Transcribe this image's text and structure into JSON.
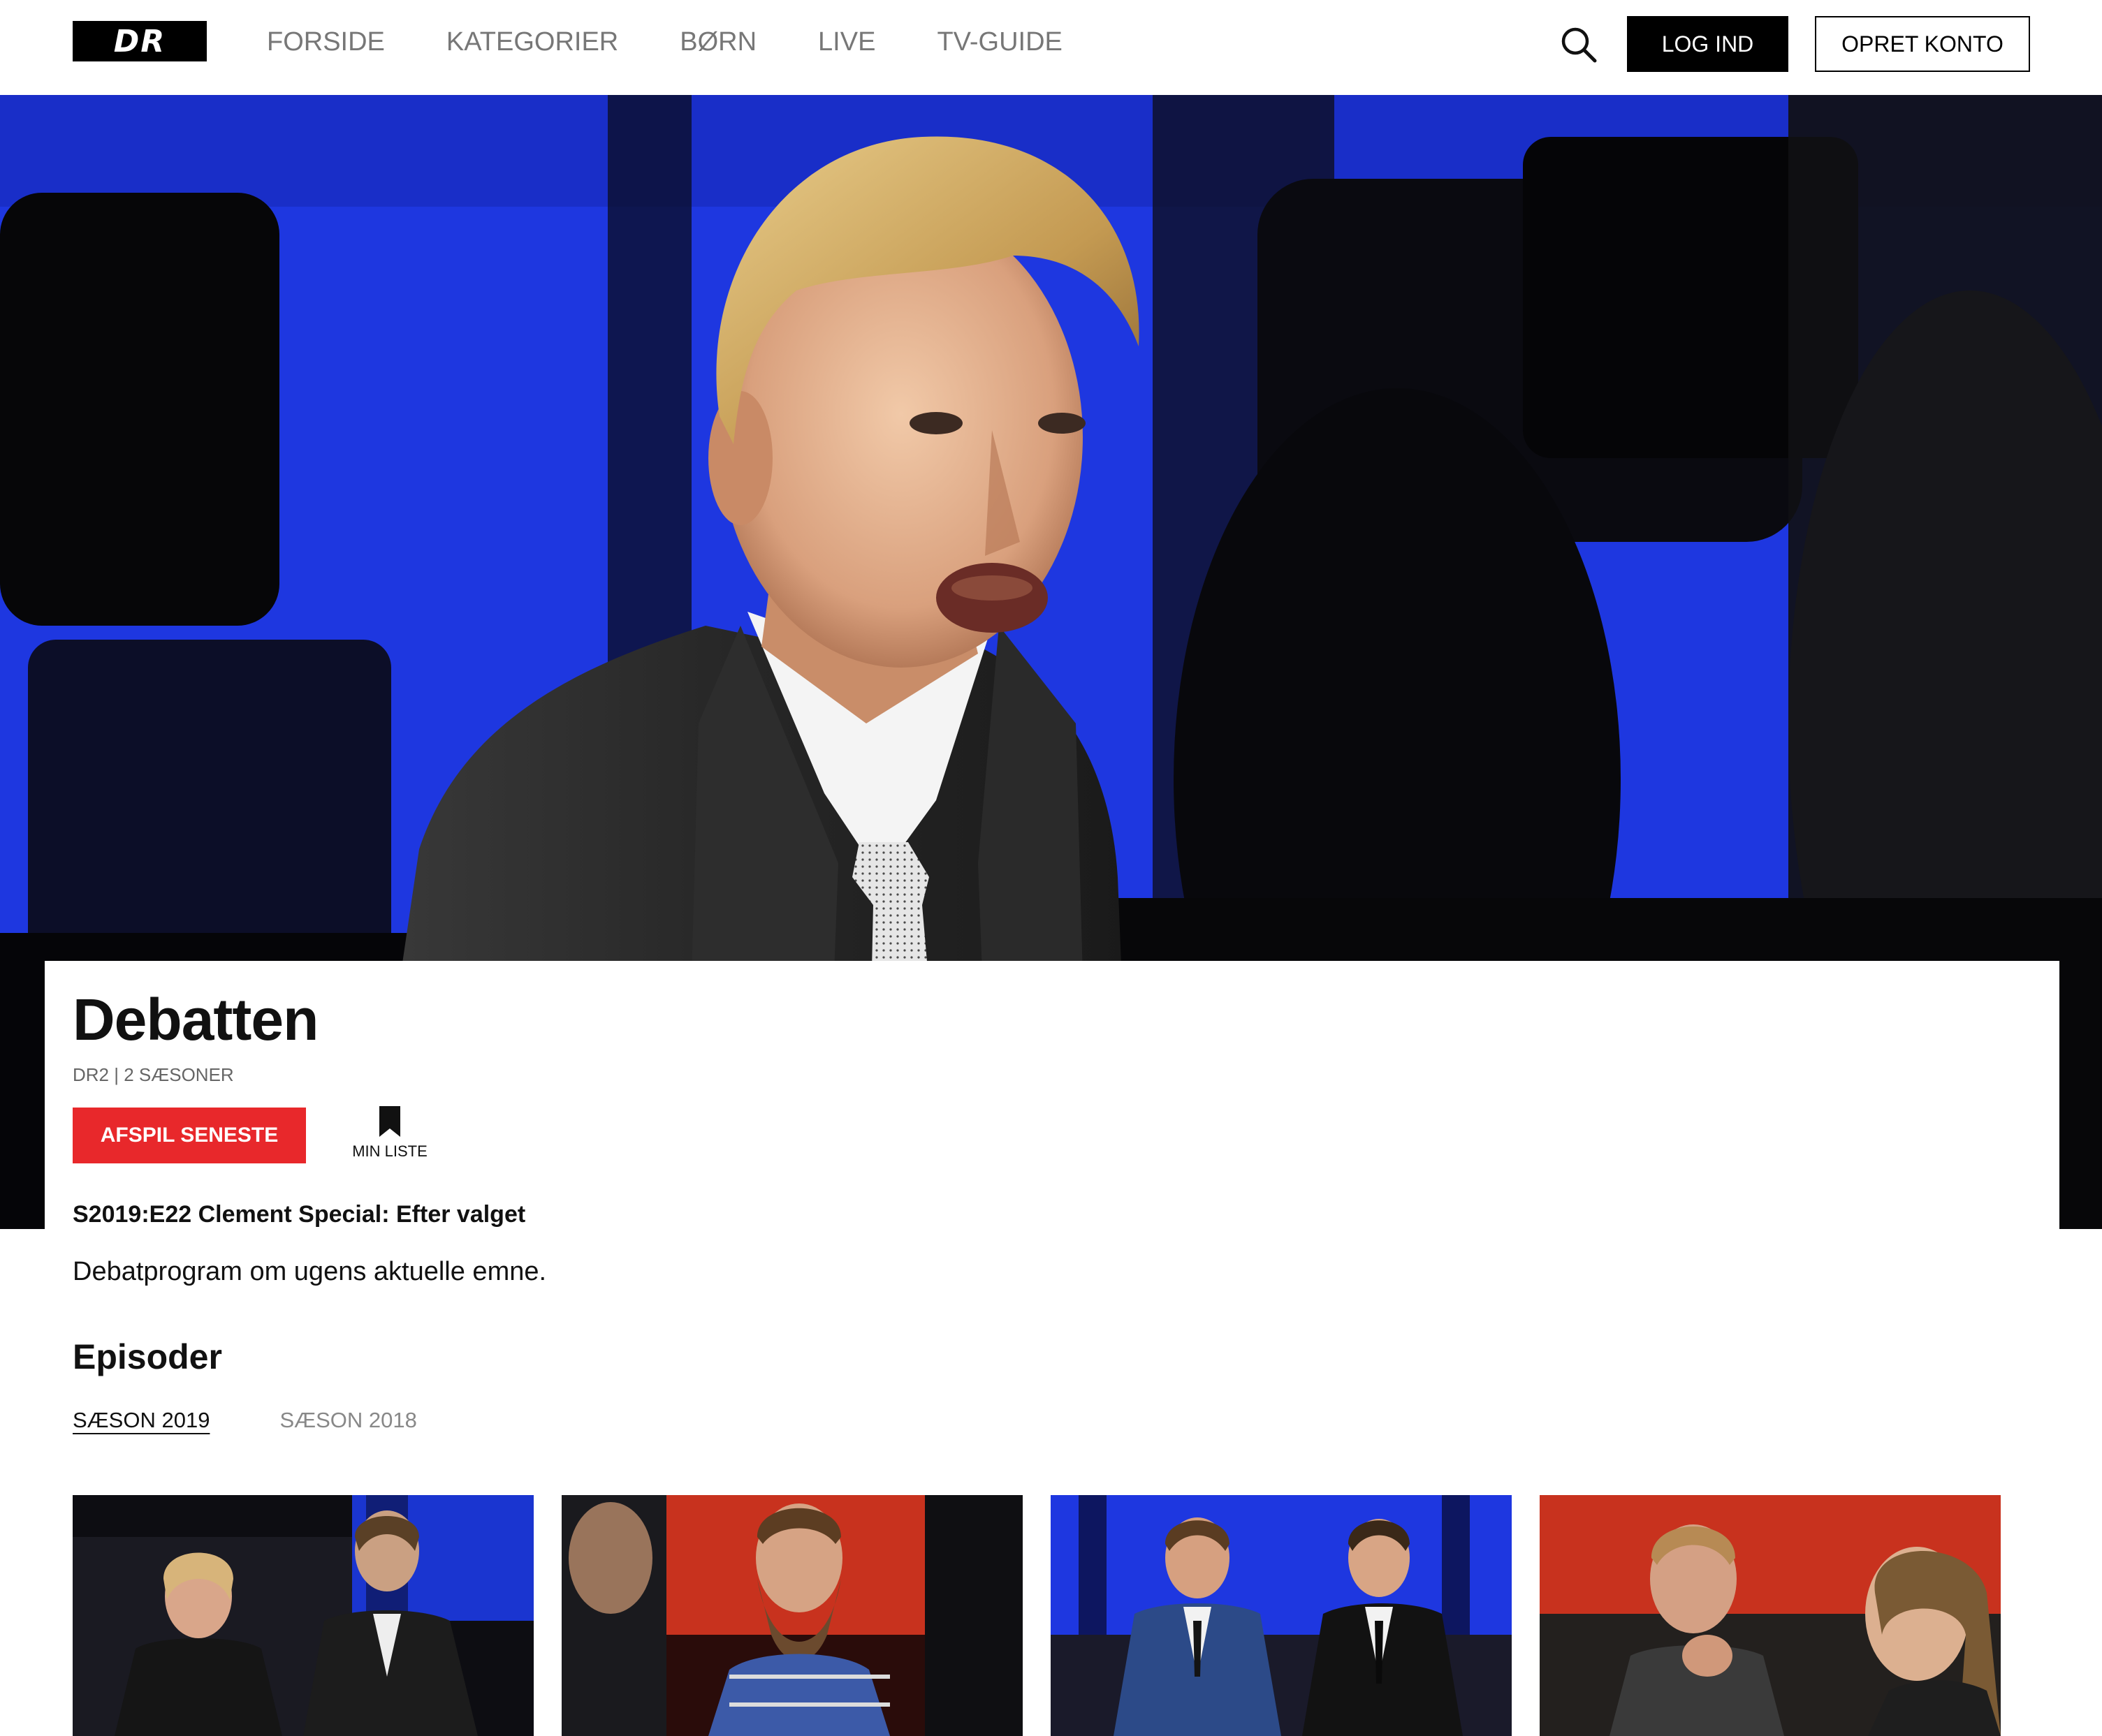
{
  "header": {
    "logo_text": "DR",
    "nav": [
      "FORSIDE",
      "KATEGORIER",
      "BØRN",
      "LIVE",
      "TV-GUIDE"
    ],
    "search_icon": "search-icon",
    "login_label": "LOG IND",
    "signup_label": "OPRET KONTO"
  },
  "show": {
    "title": "Debatten",
    "meta": "DR2 | 2 SÆSONER",
    "play_label": "AFSPIL SENESTE",
    "mylist_label": "MIN LISTE",
    "mylist_icon": "bookmark-icon",
    "episode_title": "S2019:E22 Clement Special: Efter valget",
    "description": "Debatprogram om ugens aktuelle emne."
  },
  "episodes": {
    "heading": "Episoder",
    "seasons": [
      "SÆSON 2019",
      "SÆSON 2018"
    ],
    "active_season": "SÆSON 2019"
  },
  "colors": {
    "accent_red": "#e8282b",
    "studio_blue": "#1e37e0",
    "studio_red": "#c8321e",
    "black": "#000000"
  }
}
